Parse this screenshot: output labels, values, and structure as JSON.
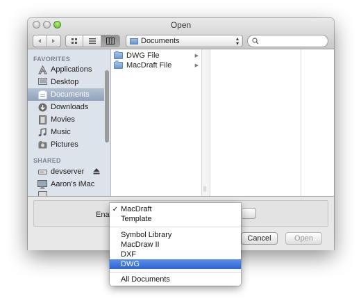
{
  "window": {
    "title": "Open"
  },
  "toolbar": {
    "back_icon": "chevron-left-icon",
    "forward_icon": "chevron-right-icon",
    "view_icons": [
      "icon-view-icon",
      "list-view-icon",
      "column-view-icon"
    ],
    "location": "Documents",
    "search_placeholder": ""
  },
  "sidebar": {
    "favorites_header": "FAVORITES",
    "favorites": [
      {
        "label": "Applications",
        "icon": "applications-icon"
      },
      {
        "label": "Desktop",
        "icon": "desktop-icon"
      },
      {
        "label": "Documents",
        "icon": "documents-icon",
        "selected": true
      },
      {
        "label": "Downloads",
        "icon": "downloads-icon"
      },
      {
        "label": "Movies",
        "icon": "movies-icon"
      },
      {
        "label": "Music",
        "icon": "music-icon"
      },
      {
        "label": "Pictures",
        "icon": "pictures-icon"
      }
    ],
    "shared_header": "SHARED",
    "shared": [
      {
        "label": "devserver",
        "icon": "server-icon",
        "eject": true
      },
      {
        "label": "Aaron's iMac",
        "icon": "imac-icon"
      }
    ]
  },
  "browser": {
    "column1": [
      {
        "label": "DWG File"
      },
      {
        "label": "MacDraft File"
      }
    ]
  },
  "bottom": {
    "enable_label": "Enable",
    "cancel_label": "Cancel",
    "open_label": "Open"
  },
  "format_menu": {
    "items": [
      {
        "label": "MacDraft",
        "checked": true
      },
      {
        "label": "Template"
      },
      {
        "label": "Symbol Library"
      },
      {
        "label": "MacDraw II"
      },
      {
        "label": "DXF"
      },
      {
        "label": "DWG",
        "highlighted": true
      },
      {
        "label": "All Documents"
      }
    ]
  }
}
